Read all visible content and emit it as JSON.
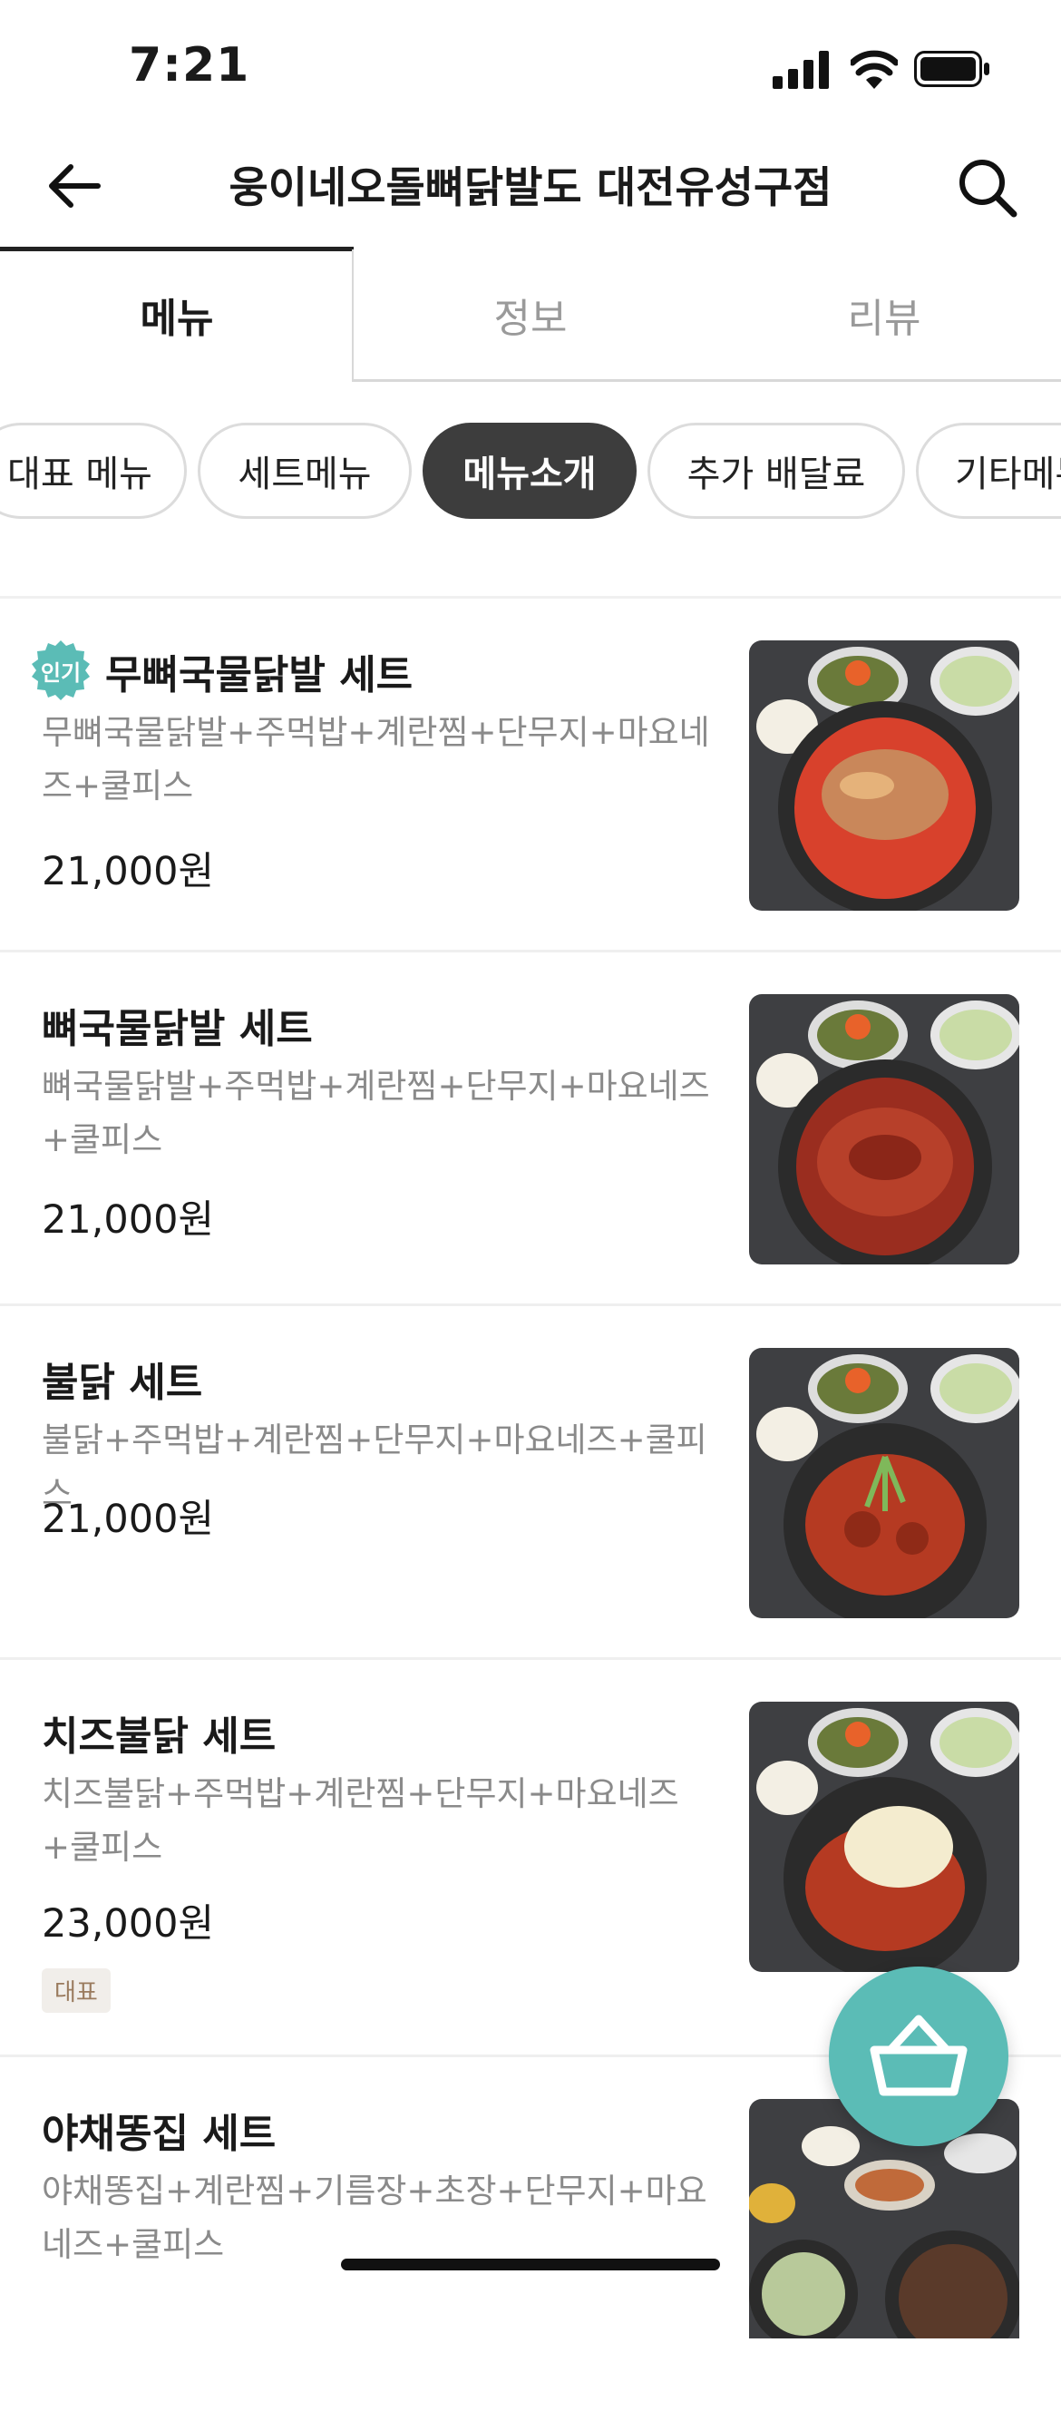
{
  "status_bar": {
    "time": "7:21"
  },
  "header": {
    "title": "웅이네오돌뼈닭발도 대전유성구점"
  },
  "tabs": [
    {
      "label": "메뉴",
      "active": true
    },
    {
      "label": "정보",
      "active": false
    },
    {
      "label": "리뷰",
      "active": false
    }
  ],
  "categories": [
    {
      "label": "대표 메뉴",
      "active": false
    },
    {
      "label": "세트메뉴",
      "active": false
    },
    {
      "label": "메뉴소개",
      "active": true
    },
    {
      "label": "추가 배달료",
      "active": false
    },
    {
      "label": "기타메뉴",
      "active": false
    }
  ],
  "menu_items": [
    {
      "badge": "인기",
      "name": "무뼈국물닭발  세트",
      "description": "무뼈국물닭발+주먹밥+계란찜+단무지+마요네즈+쿨피스",
      "price": "21,000원",
      "image_icon": "food-photo-icon"
    },
    {
      "name": "뼈국물닭발 세트",
      "description": "뼈국물닭발+주먹밥+계란찜+단무지+마요네즈+쿨피스",
      "price": "21,000원",
      "image_icon": "food-photo-icon"
    },
    {
      "name": "불닭 세트",
      "description": "불닭+주먹밥+계란찜+단무지+마요네즈+쿨피스",
      "price": "21,000원",
      "image_icon": "food-photo-icon"
    },
    {
      "name": "치즈불닭 세트",
      "description": "치즈불닭+주먹밥+계란찜+단무지+마요네즈+쿨피스",
      "price": "23,000원",
      "tag": "대표",
      "image_icon": "food-photo-icon"
    },
    {
      "name": "야채똥집 세트",
      "description": "야채똥집+계란찜+기름장+초장+단무지+마요네즈+쿨피스",
      "price": "",
      "image_icon": "food-photo-icon"
    }
  ],
  "colors": {
    "accent": "#5bbcb6",
    "chip_active_bg": "#3d3d3d",
    "description_text": "#8a8a8a",
    "tag_bg": "#f1eeea",
    "tag_text": "#9a7b5e"
  },
  "icons": {
    "back": "arrow-left-icon",
    "search": "search-icon",
    "cart": "basket-icon"
  }
}
